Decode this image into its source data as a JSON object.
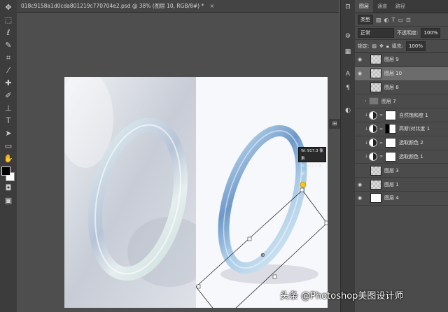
{
  "document": {
    "tab_title": "018c9158a1d0cda801219c770704e2.psd @ 38% (图层 10, RGB/8#) *",
    "close_glyph": "×"
  },
  "toolbar": {
    "tools": [
      "move-tool",
      "marquee-tool",
      "lasso-tool",
      "quick-select-tool",
      "crop-tool",
      "eyedropper-tool",
      "healing-brush-tool",
      "brush-tool",
      "clone-stamp-tool",
      "history-brush-tool",
      "eraser-tool",
      "gradient-tool",
      "blur-tool",
      "dodge-tool",
      "pen-tool",
      "type-tool",
      "path-select-tool",
      "shape-tool",
      "hand-tool",
      "zoom-tool"
    ],
    "foreground_color": "#000000",
    "background_color": "#ffffff"
  },
  "transform_info": {
    "width_label": "W: 917.3 像素",
    "height_label": "H: 261.4 像素"
  },
  "layers_panel": {
    "tabs": [
      "图层",
      "通道",
      "路径"
    ],
    "active_tab": "图层",
    "filter_label": "类型",
    "blend_mode": "正常",
    "opacity_label": "不透明度:",
    "opacity_value": "100%",
    "lock_label": "锁定:",
    "fill_label": "填充:",
    "fill_value": "100%",
    "layers": [
      {
        "name": "图层 9",
        "visible": true,
        "selected": false,
        "kind": "pixel"
      },
      {
        "name": "图层 10",
        "visible": true,
        "selected": true,
        "kind": "pixel"
      },
      {
        "name": "图层 8",
        "visible": false,
        "selected": false,
        "kind": "pixel"
      },
      {
        "name": "图层 7",
        "visible": false,
        "selected": false,
        "kind": "group"
      },
      {
        "name": "自然饱和度 1",
        "visible": false,
        "selected": false,
        "kind": "adjustment"
      },
      {
        "name": "高斯/对比度 1",
        "visible": false,
        "selected": false,
        "kind": "adjustment"
      },
      {
        "name": "选取颜色 2",
        "visible": false,
        "selected": false,
        "kind": "adjustment"
      },
      {
        "name": "选取颜色 1",
        "visible": false,
        "selected": false,
        "kind": "adjustment"
      },
      {
        "name": "图层 3",
        "visible": false,
        "selected": false,
        "kind": "pixel"
      },
      {
        "name": "图层 1",
        "visible": true,
        "selected": false,
        "kind": "pixel"
      },
      {
        "name": "图层 4",
        "visible": true,
        "selected": false,
        "kind": "white"
      }
    ]
  },
  "watermark": "头条 @Photoshop美图设计师"
}
